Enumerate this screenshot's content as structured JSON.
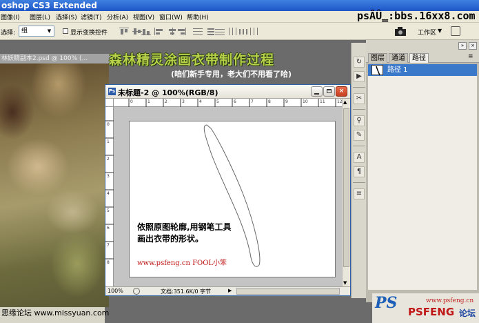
{
  "app": {
    "title": "oshop CS3 Extended"
  },
  "menu": {
    "items": [
      "图像(I)",
      "图层(L)",
      "选择(S)",
      "滤镜(T)",
      "分析(A)",
      "视图(V)",
      "窗口(W)",
      "帮助(H)"
    ]
  },
  "site_text": "psÂÛ̳:bbs.16xx8.com",
  "options": {
    "select_label": "选择:",
    "select_value": "组",
    "checkbox_label": "显示变换控件",
    "checkbox_checked": false,
    "workspace_label": "工作区"
  },
  "photo_doc": {
    "title": "林妖精副本2.psd @ 100% (..."
  },
  "header": {
    "title": "森林精灵涂画衣带制作过程",
    "subtitle": "(咱们新手专用，老大们不用看了哈)"
  },
  "doc": {
    "title": "未标题-2 @ 100%(RGB/8)",
    "zoom": "100%",
    "info": "文档:351.6K/0 字节",
    "instruction_line1": "依照原图轮廓,用钢笔工具",
    "instruction_line2": "画出衣带的形状。",
    "credit": "www.psfeng.cn  FOOL小笨",
    "ruler_top_ticks": [
      "0",
      "1",
      "2",
      "3",
      "4",
      "5",
      "6",
      "7",
      "8",
      "9",
      "10",
      "11",
      "12"
    ],
    "ruler_left_ticks": [
      "0",
      "1",
      "2",
      "3",
      "4",
      "5",
      "6",
      "7",
      "8"
    ]
  },
  "panel": {
    "tabs": [
      "图层",
      "通道",
      "路径"
    ],
    "active_tab": "路径",
    "path_item": "路径 1"
  },
  "forum_label": "思缘论坛  www.missyuan.com",
  "footer": {
    "ps_logo": "PS",
    "url": "www.psfeng.cn",
    "brand": "PSFENG",
    "forum": "论坛"
  },
  "colors": {
    "accent_blue": "#3a78c9",
    "title_green": "#b8d04a",
    "credit_red": "#c01010"
  },
  "tool_icons": [
    "history-brush-icon",
    "action-play-icon",
    "tool-presets-icon",
    "clone-source-icon",
    "brushes-icon",
    "character-icon",
    "paragraph-icon",
    "info-icon"
  ]
}
